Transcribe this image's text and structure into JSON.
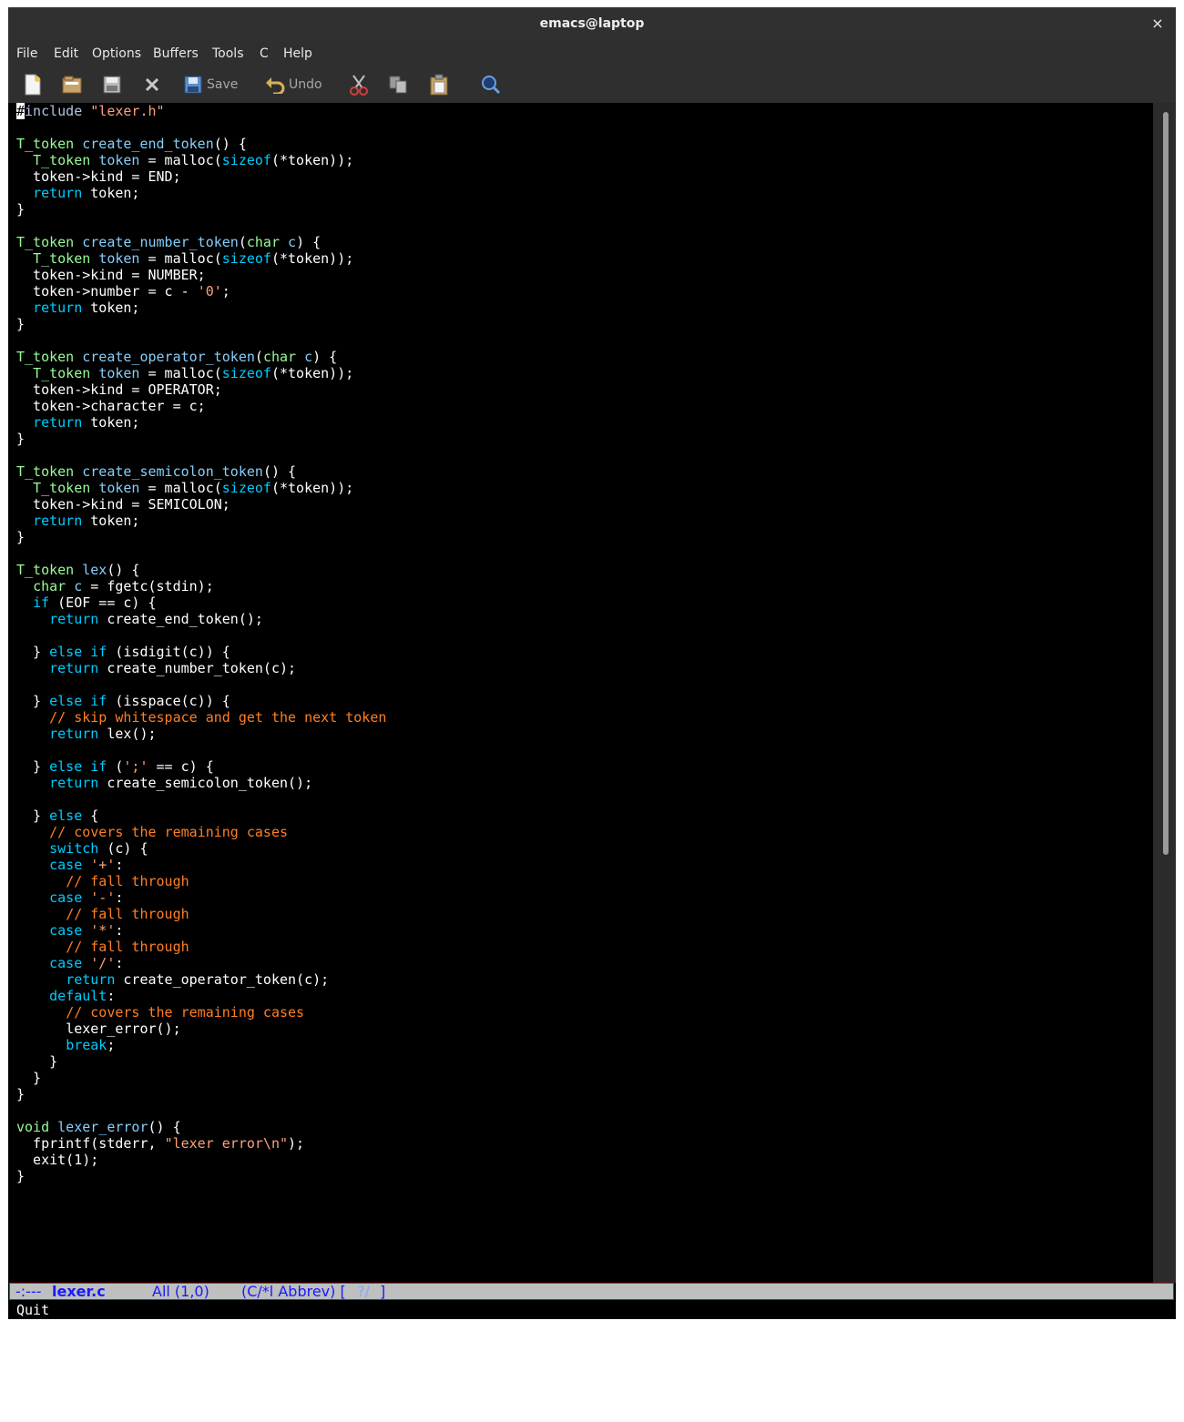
{
  "window": {
    "title": "emacs@laptop",
    "close_glyph": "×"
  },
  "menubar": {
    "items": [
      "File",
      "Edit",
      "Options",
      "Buffers",
      "Tools",
      "C",
      "Help"
    ]
  },
  "toolbar": {
    "new_icon": "new-file-icon",
    "open_icon": "open-folder-icon",
    "dired_icon": "disk-icon",
    "close_icon": "close-x-icon",
    "save_label": "Save",
    "undo_label": "Undo",
    "cut_icon": "scissors-icon",
    "copy_icon": "copy-icon",
    "paste_icon": "paste-icon",
    "search_icon": "search-icon"
  },
  "editor": {
    "lines": [
      "#include \"lexer.h\"",
      "",
      "T_token create_end_token() {",
      "  T_token token = malloc(sizeof(*token));",
      "  token->kind = END;",
      "  return token;",
      "}",
      "",
      "T_token create_number_token(char c) {",
      "  T_token token = malloc(sizeof(*token));",
      "  token->kind = NUMBER;",
      "  token->number = c - '0';",
      "  return token;",
      "}",
      "",
      "T_token create_operator_token(char c) {",
      "  T_token token = malloc(sizeof(*token));",
      "  token->kind = OPERATOR;",
      "  token->character = c;",
      "  return token;",
      "}",
      "",
      "T_token create_semicolon_token() {",
      "  T_token token = malloc(sizeof(*token));",
      "  token->kind = SEMICOLON;",
      "  return token;",
      "}",
      "",
      "T_token lex() {",
      "  char c = fgetc(stdin);",
      "  if (EOF == c) {",
      "    return create_end_token();",
      "",
      "  } else if (isdigit(c)) {",
      "    return create_number_token(c);",
      "",
      "  } else if (isspace(c)) {",
      "    // skip whitespace and get the next token",
      "    return lex();",
      "",
      "  } else if (';' == c) {",
      "    return create_semicolon_token();",
      "",
      "  } else {",
      "    // covers the remaining cases",
      "    switch (c) {",
      "    case '+':",
      "      // fall through",
      "    case '-':",
      "      // fall through",
      "    case '*':",
      "      // fall through",
      "    case '/':",
      "      return create_operator_token(c);",
      "    default:",
      "      // covers the remaining cases",
      "      lexer_error();",
      "      break;",
      "    }",
      "  }",
      "}",
      "",
      "void lexer_error() {",
      "  fprintf(stderr, \"lexer error\\n\");",
      "  exit(1);",
      "}"
    ]
  },
  "modeline": {
    "status": "-:---",
    "buffer_name": "lexer.c",
    "position": "All (1,0)",
    "modes_open": "(C/*l Abbrev) [",
    "modes_mid": "?/",
    "modes_close": "]"
  },
  "echo_area": {
    "message": "Quit"
  },
  "colors": {
    "keyword": "#00ccff",
    "type": "#98fb98",
    "function": "#87cefa",
    "comment": "#ff7f24",
    "string": "#ffa07a"
  }
}
